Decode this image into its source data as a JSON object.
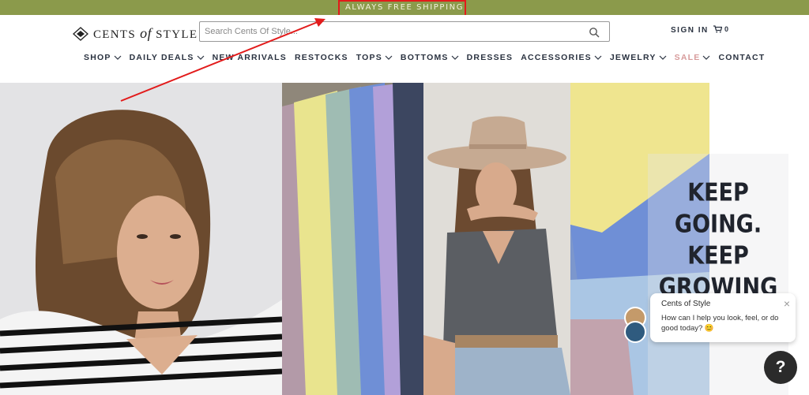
{
  "topbar": {
    "text": "ALWAYS FREE SHIPPING"
  },
  "header": {
    "logo_left": "CENTS",
    "logo_mid": "of",
    "logo_right": "STYLE",
    "search_placeholder": "Search Cents Of Style...",
    "signin": "SIGN IN",
    "cart_count": "0"
  },
  "nav": {
    "items": [
      {
        "label": "SHOP"
      },
      {
        "label": "DAILY DEALS"
      },
      {
        "label": "NEW ARRIVALS"
      },
      {
        "label": "RESTOCKS"
      },
      {
        "label": "TOPS"
      },
      {
        "label": "BOTTOMS"
      },
      {
        "label": "DRESSES"
      },
      {
        "label": "ACCESSORIES"
      },
      {
        "label": "JEWELRY"
      },
      {
        "label": "SALE"
      },
      {
        "label": "CONTACT"
      }
    ]
  },
  "hero": {
    "lines": [
      "KEEP",
      "GOING.",
      "KEEP",
      "GROWING"
    ]
  },
  "chat": {
    "title": "Cents of Style",
    "message": "How can I help you look, feel, or do good today? 😊",
    "close": "×"
  },
  "help": {
    "label": "?"
  },
  "colors": {
    "topbar": "#8b9a4b",
    "nav_text": "#2a3240",
    "sale": "#d79b9b",
    "annotation": "#e21b1b"
  }
}
